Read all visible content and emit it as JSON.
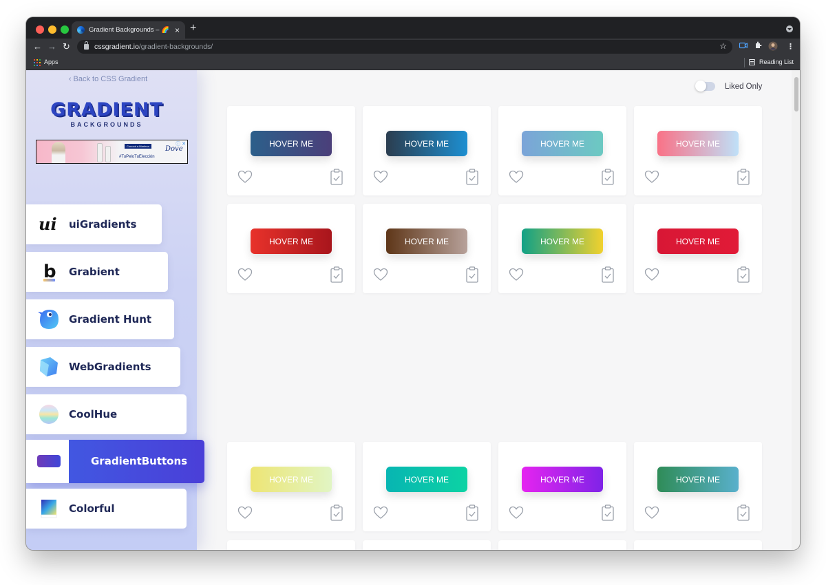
{
  "browser": {
    "tab_title": "Gradient Backgrounds – 🌈 The",
    "tab_close": "×",
    "new_tab": "+",
    "url_host": "cssgradient.io",
    "url_path": "/gradient-backgrounds/",
    "bookmarks": {
      "apps_label": "Apps",
      "reading_list_label": "Reading List"
    }
  },
  "sidebar": {
    "back_link": "‹ Back to CSS Gradient",
    "logo_title": "GRADIENT",
    "logo_subtitle": "BACKGROUNDS",
    "ad": {
      "tag": "Conocé a Marlena",
      "hashtag": "#TuPeloTuElección",
      "brand": "Dove",
      "close": "ⓘ ✕"
    },
    "items": [
      {
        "label": "uiGradients",
        "icon": "ui-logo-icon",
        "active": false
      },
      {
        "label": "Grabient",
        "icon": "b-logo-icon",
        "active": false
      },
      {
        "label": "Gradient Hunt",
        "icon": "bird-logo-icon",
        "active": false
      },
      {
        "label": "WebGradients",
        "icon": "cube-logo-icon",
        "active": false
      },
      {
        "label": "CoolHue",
        "icon": "sphere-logo-icon",
        "active": false
      },
      {
        "label": "GradientButtons",
        "icon": "button-swatch-icon",
        "active": true
      },
      {
        "label": "Colorful",
        "icon": "square-swatch-icon",
        "active": false
      }
    ]
  },
  "filter": {
    "liked_only_label": "Liked Only",
    "liked_only_on": false
  },
  "cards": [
    {
      "label": "HOVER ME",
      "colors": [
        "#2c5f8a",
        "#4b3f7a"
      ]
    },
    {
      "label": "HOVER ME",
      "colors": [
        "#2b3d4f",
        "#1d8fd1"
      ]
    },
    {
      "label": "HOVER ME",
      "colors": [
        "#7ba4d8",
        "#6cc9c2"
      ]
    },
    {
      "label": "HOVER ME",
      "colors": [
        "#f97287",
        "#bfe0f8"
      ]
    },
    {
      "label": "HOVER ME",
      "colors": [
        "#e8322b",
        "#a8151c"
      ]
    },
    {
      "label": "HOVER ME",
      "colors": [
        "#5e3618",
        "#b7a19a"
      ]
    },
    {
      "label": "HOVER ME",
      "colors": [
        "#11a186",
        "#f1d12e"
      ]
    },
    {
      "label": "HOVER ME",
      "colors": [
        "#d81735",
        "#e11b37"
      ]
    },
    {
      "label": "HOVER ME",
      "colors": [
        "#ede574",
        "#e1f5c4"
      ]
    },
    {
      "label": "HOVER ME",
      "colors": [
        "#07b5b2",
        "#0dd3a4"
      ]
    },
    {
      "label": "HOVER ME",
      "colors": [
        "#e524f0",
        "#7f23e7"
      ]
    },
    {
      "label": "HOVER ME",
      "colors": [
        "#2f8c58",
        "#59b0cc"
      ]
    }
  ],
  "card_icons": {
    "like": "heart-icon",
    "copy": "clipboard-check-icon"
  }
}
